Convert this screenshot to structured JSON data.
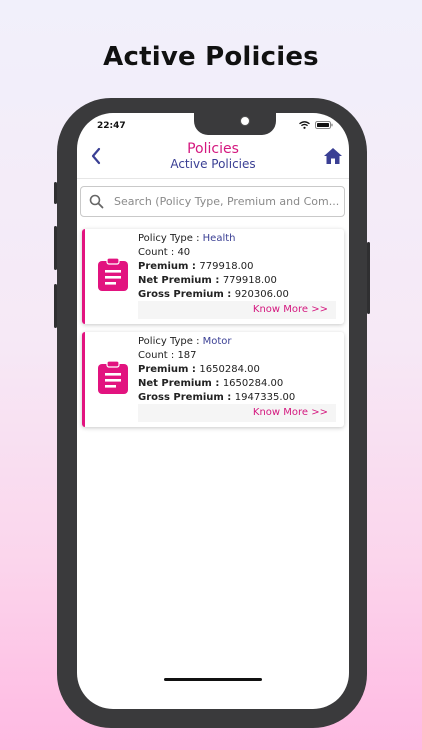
{
  "promo": {
    "title": "Active Policies"
  },
  "status_bar": {
    "time": "22:47",
    "icons": [
      "wifi-icon",
      "battery-icon"
    ]
  },
  "header": {
    "title": "Policies",
    "subtitle": "Active Policies",
    "icons": {
      "back": "chevron-left-icon",
      "home": "home-icon"
    }
  },
  "search": {
    "placeholder": "Search (Policy Type, Premium and Com...",
    "value": ""
  },
  "labels": {
    "policy_type": "Policy Type : ",
    "count": "Count : ",
    "premium": "Premium : ",
    "net_premium": "Net Premium : ",
    "gross_premium": "Gross Premium : ",
    "know_more": "Know More >>"
  },
  "policies": [
    {
      "type": "Health",
      "count": "40",
      "premium": "779918.00",
      "net_premium": "779918.00",
      "gross_premium": "920306.00"
    },
    {
      "type": "Motor",
      "count": "187",
      "premium": "1650284.00",
      "net_premium": "1650284.00",
      "gross_premium": "1947335.00"
    }
  ],
  "colors": {
    "accent": "#d4187f",
    "navy": "#3a3f94",
    "card_bar": "#e2137f",
    "phone_frame": "#3a3a3c"
  }
}
